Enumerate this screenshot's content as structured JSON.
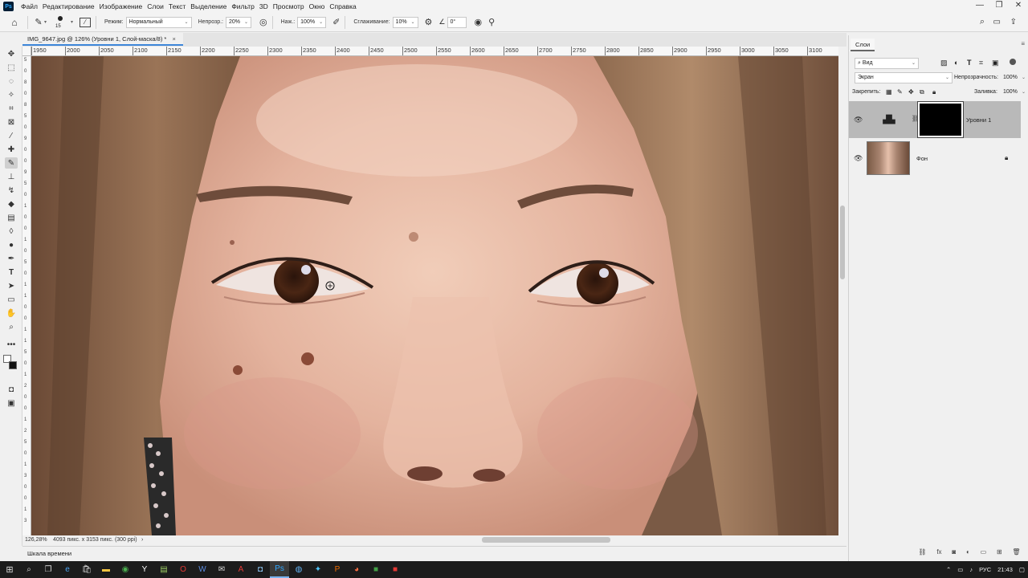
{
  "menu": {
    "logo": "Ps",
    "items": [
      "Файл",
      "Редактирование",
      "Изображение",
      "Слои",
      "Текст",
      "Выделение",
      "Фильтр",
      "3D",
      "Просмотр",
      "Окно",
      "Справка"
    ]
  },
  "window_controls": [
    "—",
    "❐",
    "✕"
  ],
  "options": {
    "brush_size": "15",
    "mode_label": "Режим:",
    "mode_value": "Нормальный",
    "opacity_label": "Непрозр.:",
    "opacity_value": "20%",
    "pressure_label": "Наж.:",
    "pressure_value": "100%",
    "smoothing_label": "Сглаживание:",
    "smoothing_value": "10%",
    "angle_value": "0°"
  },
  "document": {
    "tab_title": "IMG_9647.jpg @ 126% (Уровни 1, Слой-маска/8) *",
    "close": "×"
  },
  "ruler": {
    "h_ticks": [
      "1950",
      "2000",
      "2050",
      "2100",
      "2150",
      "2200",
      "2250",
      "2300",
      "2350",
      "2400",
      "2450",
      "2500",
      "2550",
      "2600",
      "2650",
      "2700",
      "2750",
      "2800",
      "2850",
      "2900",
      "2950",
      "3000",
      "3050",
      "3100"
    ],
    "v_ticks": [
      "5",
      "0",
      "8",
      "0",
      "8",
      "5",
      "0",
      "9",
      "0",
      "0",
      "9",
      "5",
      "0",
      "1",
      "0",
      "0",
      "1",
      "0",
      "5",
      "0",
      "1",
      "1",
      "0",
      "0",
      "1",
      "1",
      "5",
      "0",
      "1",
      "2",
      "0",
      "0",
      "1",
      "2",
      "5",
      "0",
      "1",
      "3",
      "0",
      "0",
      "1",
      "3"
    ]
  },
  "status": {
    "zoom": "126,28%",
    "doc_info": "4093 пикс. x 3153 пикс. (300 ppi)",
    "arrow": "›"
  },
  "timeline": {
    "label": "Шкала времени"
  },
  "layers_panel": {
    "tab": "Слои",
    "filter_kind": "Вид",
    "blend_mode": "Экран",
    "opacity_label": "Непрозрачность:",
    "opacity_value": "100%",
    "lock_label": "Закрепить:",
    "fill_label": "Заливка:",
    "fill_value": "100%",
    "layers": [
      {
        "name": "Уровни 1",
        "selected": true
      },
      {
        "name": "Фон",
        "selected": false
      }
    ]
  },
  "taskbar": {
    "lang": "РУС",
    "time": "21:43",
    "apps": [
      "start-icon",
      "search-icon",
      "taskview-icon",
      "edge-icon",
      "store-icon",
      "explorer-icon",
      "chrome-icon",
      "yandex-icon",
      "notepad-icon",
      "opera-icon",
      "word-icon",
      "mail-icon",
      "acrobat-icon",
      "app-icon",
      "photoshop-icon",
      "globe-icon",
      "twitter-icon",
      "ppt-icon",
      "firefox-icon",
      "green-app-icon",
      "red-app-icon"
    ]
  },
  "colors": {
    "accent": "#3d86d9",
    "taskbar": "#1c1c1c",
    "selected_layer": "#b9b9b9"
  }
}
